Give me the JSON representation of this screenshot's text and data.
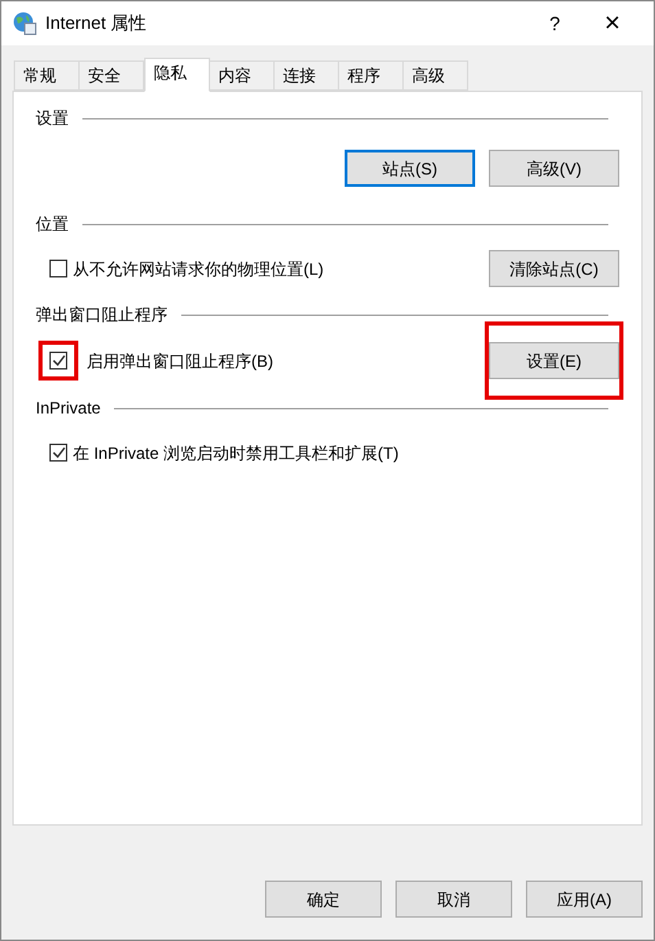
{
  "window": {
    "title": "Internet 属性",
    "help": "?",
    "close": "×"
  },
  "tabs": [
    {
      "label": "常规",
      "selected": false
    },
    {
      "label": "安全",
      "selected": false
    },
    {
      "label": "隐私",
      "selected": true
    },
    {
      "label": "内容",
      "selected": false
    },
    {
      "label": "连接",
      "selected": false
    },
    {
      "label": "程序",
      "selected": false
    },
    {
      "label": "高级",
      "selected": false
    }
  ],
  "groups": [
    {
      "title": "设置",
      "rows": [
        {
          "kind": "buttons",
          "buttons": [
            {
              "label": "站点(S)",
              "focused": true,
              "highlighted": false
            },
            {
              "label": "高级(V)",
              "focused": false,
              "highlighted": false
            }
          ]
        }
      ]
    },
    {
      "title": "位置",
      "rows": [
        {
          "kind": "checkbox",
          "label": "从不允许网站请求你的物理位置(L)",
          "checked": false,
          "highlighted": false,
          "button": {
            "label": "清除站点(C)",
            "focused": false,
            "highlighted": false
          }
        }
      ]
    },
    {
      "title": "弹出窗口阻止程序",
      "rows": [
        {
          "kind": "checkbox",
          "label": "启用弹出窗口阻止程序(B)",
          "checked": true,
          "highlighted": true,
          "button": {
            "label": "设置(E)",
            "focused": false,
            "highlighted": true
          }
        }
      ]
    },
    {
      "title": "InPrivate",
      "rows": [
        {
          "kind": "checkbox",
          "label": "在 InPrivate 浏览启动时禁用工具栏和扩展(T)",
          "checked": true,
          "highlighted": false
        }
      ]
    }
  ],
  "footer_buttons": [
    "确定",
    "取消",
    "应用(A)"
  ]
}
